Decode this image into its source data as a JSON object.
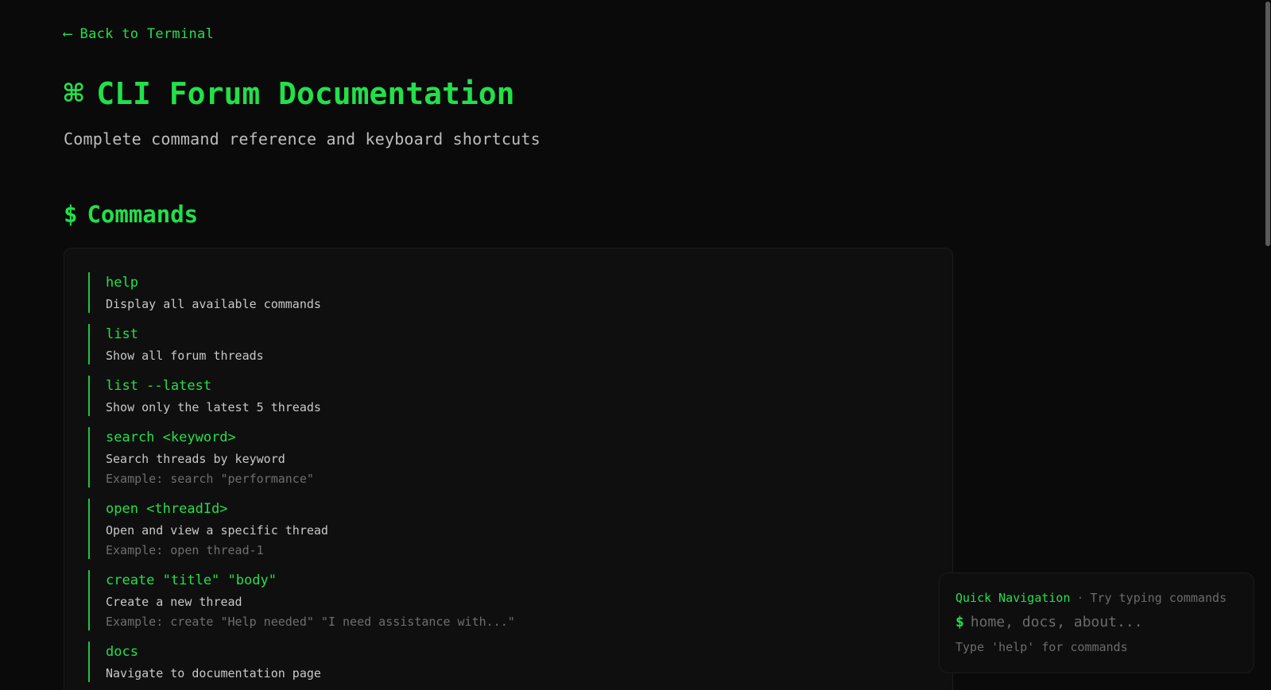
{
  "nav": {
    "back_arrow": "⟵",
    "back_label": "Back to Terminal"
  },
  "header": {
    "icon": "⌘",
    "title": "CLI Forum Documentation",
    "subtitle": "Complete command reference and keyboard shortcuts"
  },
  "commands_section": {
    "prefix": "$",
    "title": "Commands",
    "items": [
      {
        "name": "help",
        "desc": "Display all available commands",
        "example": ""
      },
      {
        "name": "list",
        "desc": "Show all forum threads",
        "example": ""
      },
      {
        "name": "list --latest",
        "desc": "Show only the latest 5 threads",
        "example": ""
      },
      {
        "name": "search <keyword>",
        "desc": "Search threads by keyword",
        "example": "Example: search \"performance\""
      },
      {
        "name": "open <threadId>",
        "desc": "Open and view a specific thread",
        "example": "Example: open thread-1"
      },
      {
        "name": "create \"title\" \"body\"",
        "desc": "Create a new thread",
        "example": "Example: create \"Help needed\" \"I need assistance with...\""
      },
      {
        "name": "docs",
        "desc": "Navigate to documentation page",
        "example": ""
      }
    ]
  },
  "quick_nav": {
    "title": "Quick Navigation",
    "separator": "·",
    "hint": "Try typing commands",
    "prompt": "$",
    "placeholder": "home, docs, about...",
    "value": "",
    "footer": "Type 'help' for commands"
  },
  "colors": {
    "accent": "#22e04a",
    "background": "#0a0a0a",
    "card": "#0f0f0f",
    "muted": "#6b6b6b"
  }
}
